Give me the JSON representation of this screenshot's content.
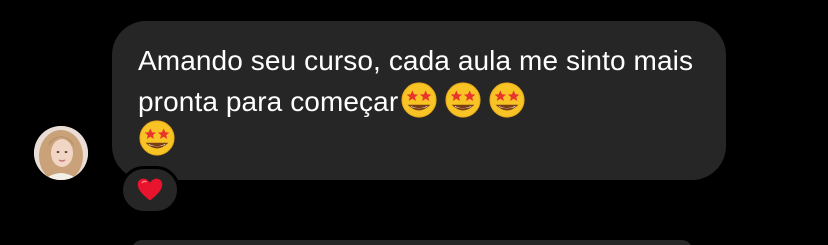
{
  "conversation": {
    "message": {
      "text": "Amando seu curso, cada aula me sinto mais pronta para começar",
      "emojis": [
        "star-struck-icon",
        "star-struck-icon",
        "star-struck-icon",
        "star-struck-icon"
      ],
      "bubble_color": "#262626",
      "text_color": "#ffffff"
    },
    "reaction": {
      "icon": "heart-icon",
      "color": "#e8132d"
    },
    "sender": {
      "avatar": "avatar"
    },
    "background_color": "#000000"
  }
}
